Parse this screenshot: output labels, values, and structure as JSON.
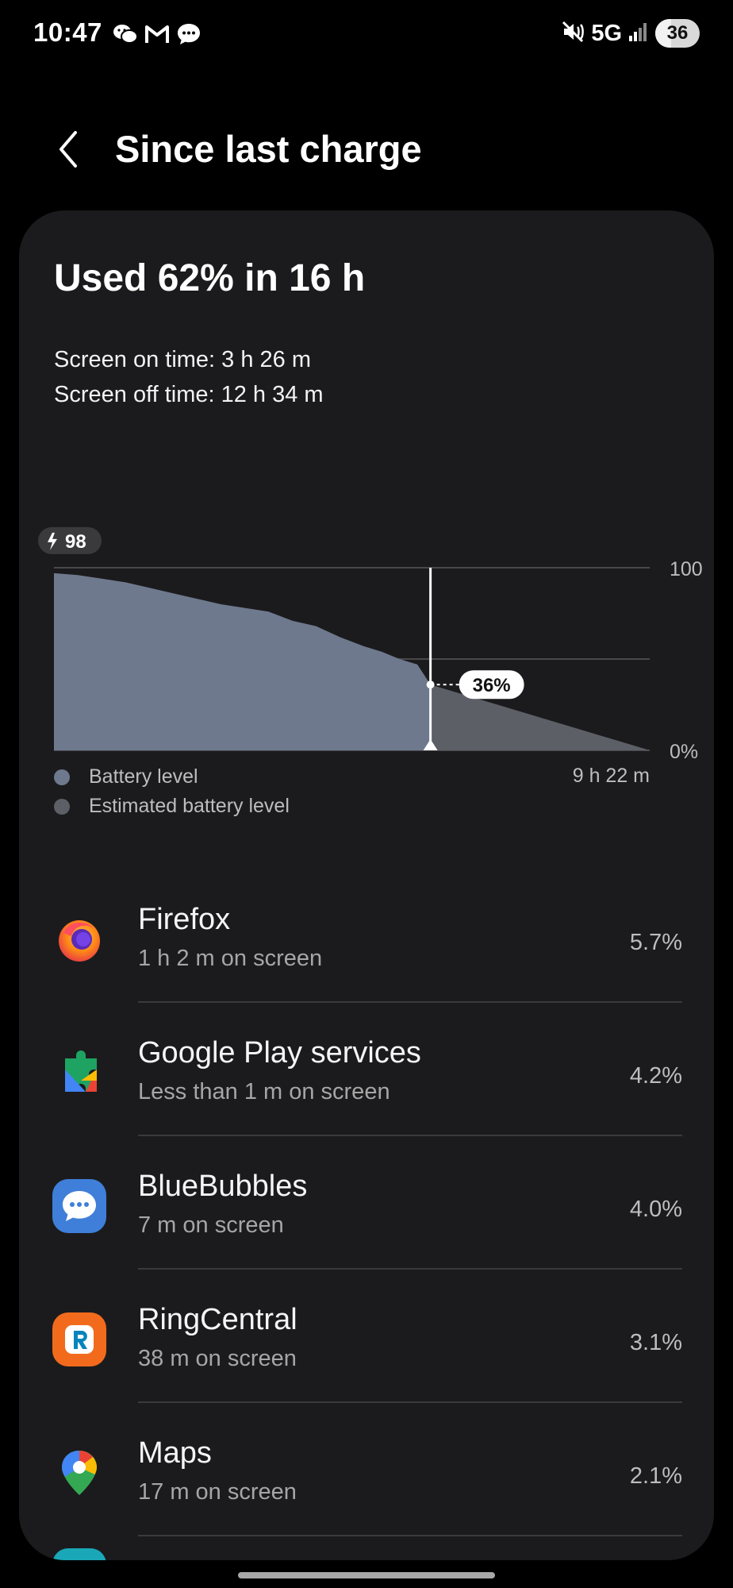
{
  "status_bar": {
    "time": "10:47",
    "network": "5G",
    "battery": "36",
    "battery_level": 0.36,
    "notification_icons": [
      "wechat-icon",
      "gmail-icon",
      "messages-icon"
    ],
    "right_icons": [
      "mute-vibrate-icon",
      "signal-icon"
    ]
  },
  "header": {
    "title": "Since last charge",
    "back_icon": "chevron-left-icon"
  },
  "summary": {
    "title": "Used 62% in 16 h",
    "screen_on": "Screen on time: 3 h 26 m",
    "screen_off": "Screen off time: 12 h 34 m"
  },
  "chart_data": {
    "type": "area",
    "start_badge": "98",
    "start_badge_icon": "lightning-icon",
    "y_labels": [
      "100",
      "0%"
    ],
    "ylim": [
      0,
      100
    ],
    "x_end_label": "9 h 22 m",
    "marker_label": "36%",
    "series": [
      {
        "name": "Battery level",
        "color": "#6e798e",
        "x_fraction": [
          0,
          0.04,
          0.08,
          0.12,
          0.16,
          0.2,
          0.24,
          0.28,
          0.32,
          0.36,
          0.4,
          0.44,
          0.48,
          0.52,
          0.55,
          0.58,
          0.61,
          0.632
        ],
        "values": [
          97,
          96,
          94,
          92,
          89,
          86,
          83,
          80,
          78,
          76,
          71,
          68,
          62,
          57,
          54,
          50,
          47,
          36
        ]
      },
      {
        "name": "Estimated battery level",
        "color": "#5c5f66",
        "x_fraction": [
          0.632,
          1.0
        ],
        "values": [
          36,
          0
        ]
      }
    ]
  },
  "legend": [
    {
      "label": "Battery level",
      "color": "#6e798e"
    },
    {
      "label": "Estimated battery level",
      "color": "#5c5f66"
    }
  ],
  "apps": [
    {
      "name": "Firefox",
      "sub": "1 h 2 m on screen",
      "pct": "5.7%",
      "icon": "firefox-icon"
    },
    {
      "name": "Google Play services",
      "sub": "Less than 1 m on screen",
      "pct": "4.2%",
      "icon": "google-play-services-icon"
    },
    {
      "name": "BlueBubbles",
      "sub": "7 m on screen",
      "pct": "4.0%",
      "icon": "bluebubbles-icon"
    },
    {
      "name": "RingCentral",
      "sub": "38 m on screen",
      "pct": "3.1%",
      "icon": "ringcentral-icon"
    },
    {
      "name": "Maps",
      "sub": "17 m on screen",
      "pct": "2.1%",
      "icon": "maps-icon"
    }
  ]
}
